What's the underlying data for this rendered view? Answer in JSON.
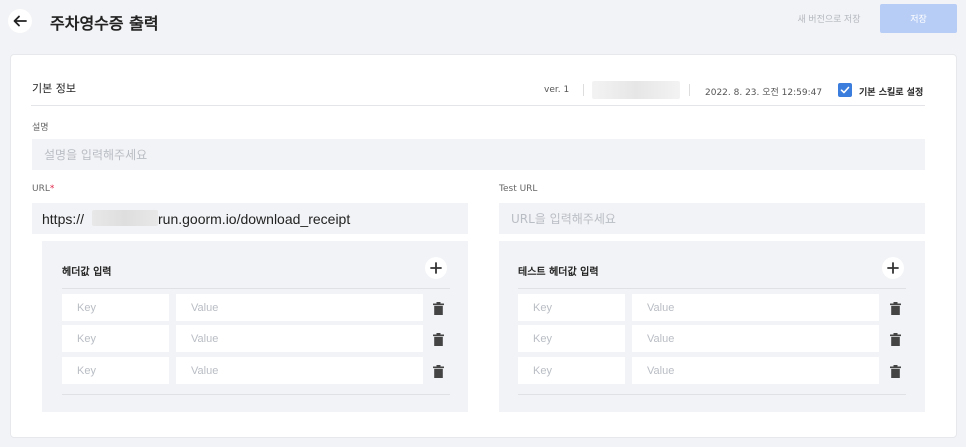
{
  "header": {
    "title": "주차영수증 출력",
    "new_version_label": "새 버전으로 저장",
    "save_label": "저장"
  },
  "basic_info": {
    "section_title": "기본 정보",
    "version": "ver. 1",
    "date": "2022. 8. 23. 오전 12:59:47",
    "default_skill_label": "기본 스킬로 설정",
    "default_skill_checked": true
  },
  "description": {
    "label": "설명",
    "placeholder": "설명을 입력해주세요",
    "value": ""
  },
  "url": {
    "label": "URL",
    "required_mark": "*",
    "value_prefix": "https://",
    "value_suffix": "run.goorm.io/download_receipt"
  },
  "test_url": {
    "label": "Test URL",
    "placeholder": "URL을 입력해주세요",
    "value": ""
  },
  "headers": {
    "title": "헤더값 입력",
    "rows": [
      {
        "key_placeholder": "Key",
        "value_placeholder": "Value"
      },
      {
        "key_placeholder": "Key",
        "value_placeholder": "Value"
      },
      {
        "key_placeholder": "Key",
        "value_placeholder": "Value"
      }
    ]
  },
  "test_headers": {
    "title": "테스트 헤더값 입력",
    "rows": [
      {
        "key_placeholder": "Key",
        "value_placeholder": "Value"
      },
      {
        "key_placeholder": "Key",
        "value_placeholder": "Value"
      },
      {
        "key_placeholder": "Key",
        "value_placeholder": "Value"
      }
    ]
  },
  "colors": {
    "accent": "#3b7ddd",
    "save_button_disabled": "#b8cdf5",
    "required": "#e0284c",
    "field_bg": "#f2f3f6"
  },
  "icons": {
    "back": "arrow-left-icon",
    "add": "plus-icon",
    "delete": "trash-icon",
    "check": "check-icon"
  }
}
